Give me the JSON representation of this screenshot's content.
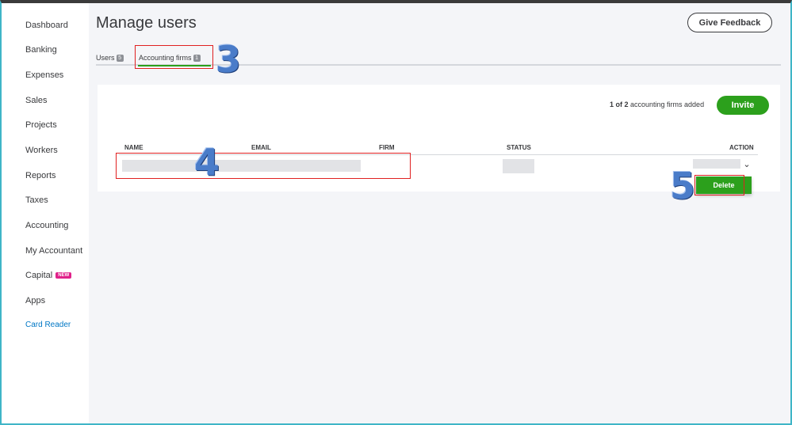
{
  "sidebar": {
    "items": [
      {
        "label": "Dashboard"
      },
      {
        "label": "Banking"
      },
      {
        "label": "Expenses"
      },
      {
        "label": "Sales"
      },
      {
        "label": "Projects"
      },
      {
        "label": "Workers"
      },
      {
        "label": "Reports"
      },
      {
        "label": "Taxes"
      },
      {
        "label": "Accounting"
      },
      {
        "label": "My Accountant"
      },
      {
        "label": "Capital",
        "badge": "NEW"
      },
      {
        "label": "Apps"
      },
      {
        "label": "Card Reader"
      }
    ]
  },
  "header": {
    "title": "Manage users",
    "feedback_label": "Give Feedback"
  },
  "tabs": [
    {
      "label": "Users",
      "count": "5"
    },
    {
      "label": "Accounting firms",
      "count": "1"
    }
  ],
  "summary": {
    "current": "1 of 2",
    "rest": " accounting firms added"
  },
  "invite_label": "Invite",
  "table": {
    "columns": [
      "NAME",
      "EMAIL",
      "FIRM",
      "STATUS",
      "ACTION"
    ]
  },
  "delete_label": "Delete",
  "chevron_glyph": "⌄",
  "annotations": [
    "3",
    "4",
    "5"
  ],
  "colors": {
    "accent_green": "#2ca01c",
    "link_blue": "#0077c5",
    "new_badge": "#e0218a",
    "annotation_red": "#e02020",
    "annotation_number": "#4a7cc9"
  }
}
